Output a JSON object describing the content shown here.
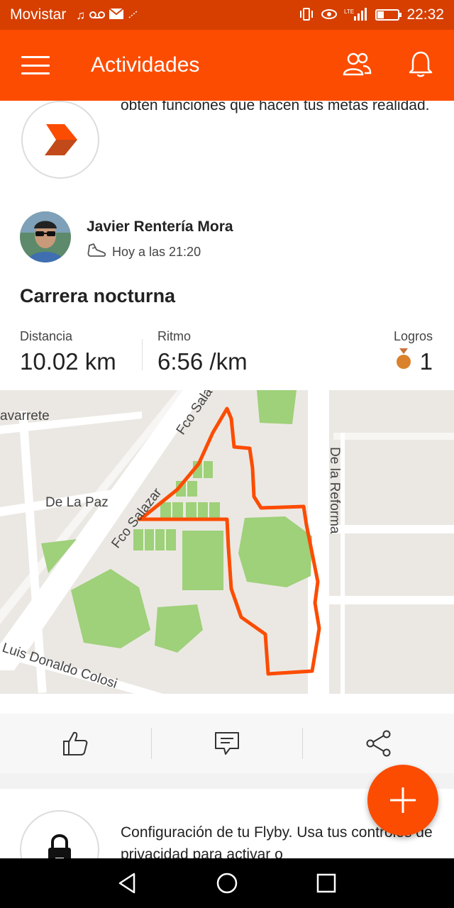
{
  "status_bar": {
    "carrier": "Movistar",
    "time": "22:32",
    "network": "LTE",
    "colors": {
      "background": "#d63f00"
    }
  },
  "app_bar": {
    "title": "Actividades",
    "colors": {
      "background": "#fc4c02"
    }
  },
  "promo_card": {
    "text": "Llega más lejos con Summit. Pásate ahora y obtén funciones que hacen tus metas realidad."
  },
  "activity": {
    "athlete_name": "Javier Rentería Mora",
    "timestamp": "Hoy a las 21:20",
    "title": "Carrera nocturna",
    "stats": {
      "distance_label": "Distancia",
      "distance_value": "10.02 km",
      "pace_label": "Ritmo",
      "pace_value": "6:56 /km",
      "achievements_label": "Logros",
      "achievements_value": "1"
    },
    "map": {
      "street_labels": {
        "navarrete": "avarrete",
        "fco_salazar_top": "Fco Sala",
        "de_la_paz": "De La Paz",
        "fco_salazar_bottom": "Fco Salazar",
        "de_la_reforma": "De la Reforma",
        "luis_donaldo": "Luis Donaldo Colosi"
      },
      "colors": {
        "route": "#fc4c02",
        "park": "#9fd07a",
        "road": "#ffffff",
        "land": "#ebe8e3"
      }
    }
  },
  "flyby_card": {
    "text": "Configuración de tu Flyby. Usa tus controles de privacidad para activar o"
  },
  "icons": {
    "menu": "hamburger-icon",
    "friends": "people-icon",
    "notifications": "bell-icon",
    "kudos": "thumbs-up-icon",
    "comment": "comment-icon",
    "share": "share-icon",
    "add": "plus-icon",
    "shoe": "shoe-icon",
    "medal": "medal-icon",
    "lock": "lock-icon"
  }
}
